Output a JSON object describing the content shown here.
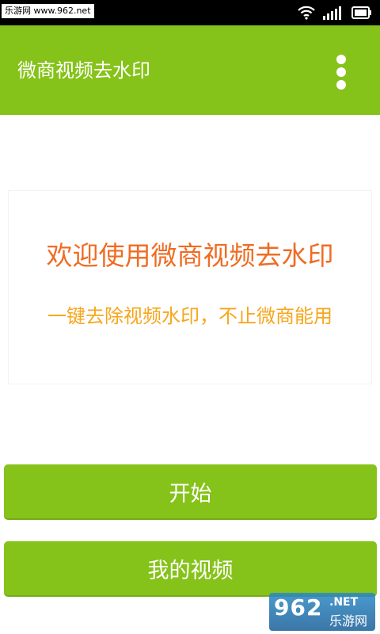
{
  "status_bar": {
    "site_label": "乐游网 www.962.net",
    "icons": [
      "wifi-icon",
      "signal-icon",
      "battery-icon"
    ]
  },
  "app_bar": {
    "title": "微商视频去水印",
    "menu_icon": "overflow-menu-icon"
  },
  "banner": {
    "title": "欢迎使用微商视频去水印",
    "subtitle": "一键去除视频水印，不止微商能用"
  },
  "buttons": {
    "start_label": "开始",
    "my_videos_label": "我的视频"
  },
  "watermark": {
    "number": "962",
    "domain": ".NET",
    "site": "乐游网"
  },
  "colors": {
    "accent_green": "#86c31a",
    "banner_title": "#ef6c24",
    "banner_subtitle": "#f7a61b"
  }
}
